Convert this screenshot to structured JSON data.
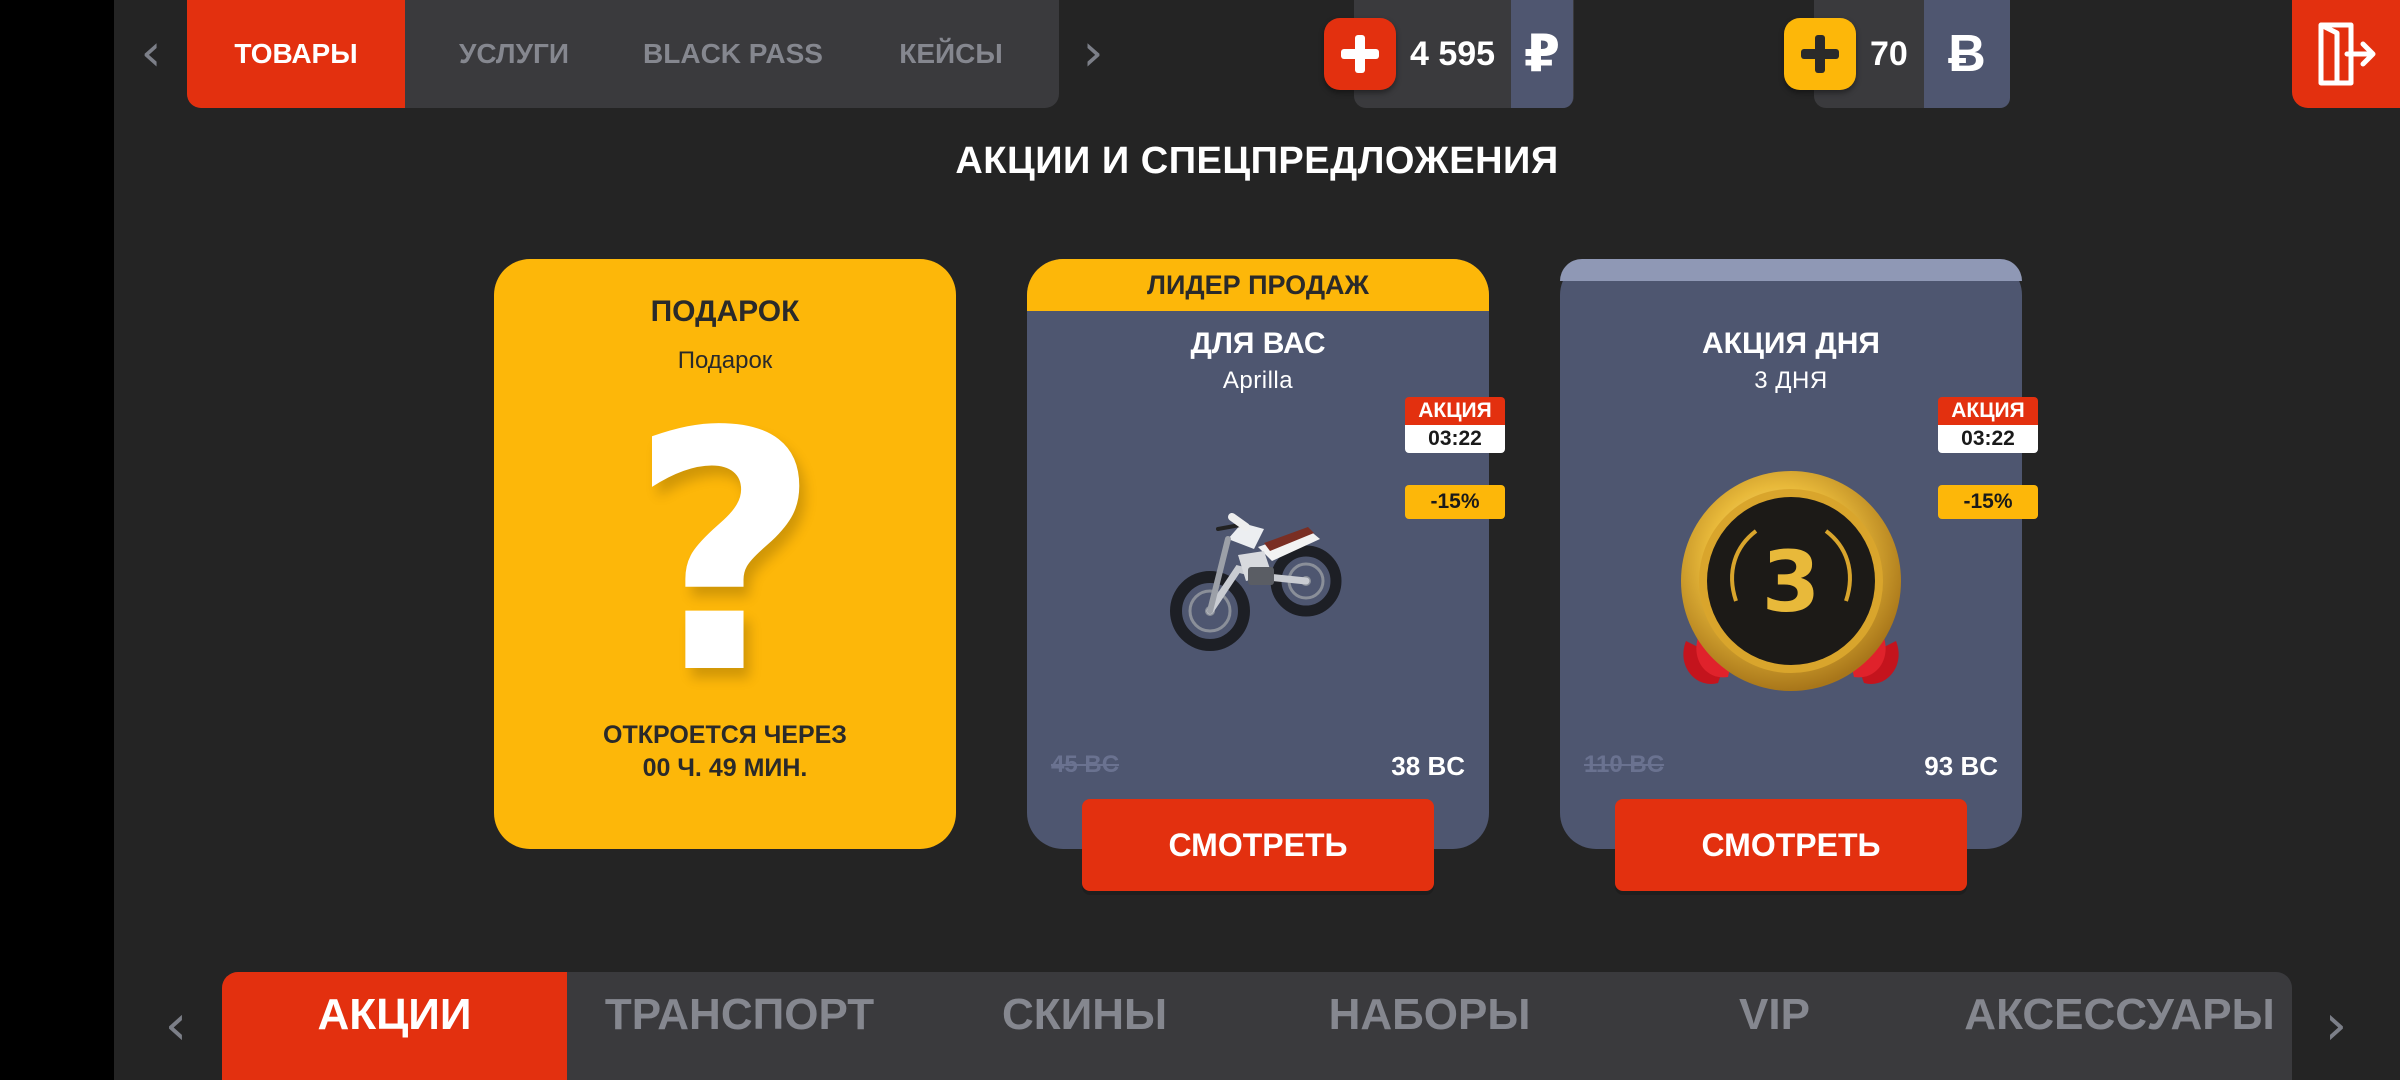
{
  "top_nav": {
    "tabs": [
      {
        "label": "ТОВАРЫ",
        "active": true
      },
      {
        "label": "УСЛУГИ",
        "active": false
      },
      {
        "label": "BLACK PASS",
        "active": false
      },
      {
        "label": "КЕЙСЫ",
        "active": false
      }
    ],
    "left_arrow_icon": "chevron-left-icon",
    "right_arrow_icon": "chevron-right-icon"
  },
  "balances": {
    "rubles": {
      "amount": "4 595",
      "symbol": "₽",
      "plus_color": "#e3300f"
    },
    "bc": {
      "amount": "70",
      "symbol": "Ƀ",
      "plus_color": "#fdb709"
    }
  },
  "exit_icon": "exit-door-icon",
  "page_title": "АКЦИИ И СПЕЦПРЕДЛОЖЕНИЯ",
  "cards": {
    "gift": {
      "title": "ПОДАРОК",
      "subtitle": "Подарок",
      "mystery": "?",
      "opens_line1": "ОТКРОЕТСЯ ЧЕРЕЗ",
      "opens_line2": "00 Ч. 49 МИН."
    },
    "for_you": {
      "ribbon": "ЛИДЕР ПРОДАЖ",
      "title": "ДЛЯ ВАС",
      "subtitle": "Aprilla",
      "promo_label": "АКЦИЯ",
      "timer": "03:22",
      "discount": "-15%",
      "old_price": "45 BC",
      "new_price": "38 BC",
      "button": "СМОТРЕТЬ",
      "image": "motorcycle-icon"
    },
    "deal_of_day": {
      "title": "АКЦИЯ ДНЯ",
      "subtitle": "3 ДНЯ",
      "promo_label": "АКЦИЯ",
      "timer": "03:22",
      "discount": "-15%",
      "old_price": "110 BC",
      "new_price": "93 BC",
      "button": "СМОТРЕТЬ",
      "image": "medal-icon",
      "medal_number": "3"
    }
  },
  "bottom_nav": {
    "tabs": [
      {
        "label": "АКЦИИ",
        "active": true
      },
      {
        "label": "ТРАНСПОРТ",
        "active": false
      },
      {
        "label": "СКИНЫ",
        "active": false
      },
      {
        "label": "НАБОРЫ",
        "active": false
      },
      {
        "label": "VIP",
        "active": false
      },
      {
        "label": "АКСЕССУАРЫ",
        "active": false
      }
    ]
  },
  "colors": {
    "accent_red": "#e3300f",
    "accent_yellow": "#fdb709",
    "card_blue": "#4e5670",
    "background": "#242424"
  }
}
